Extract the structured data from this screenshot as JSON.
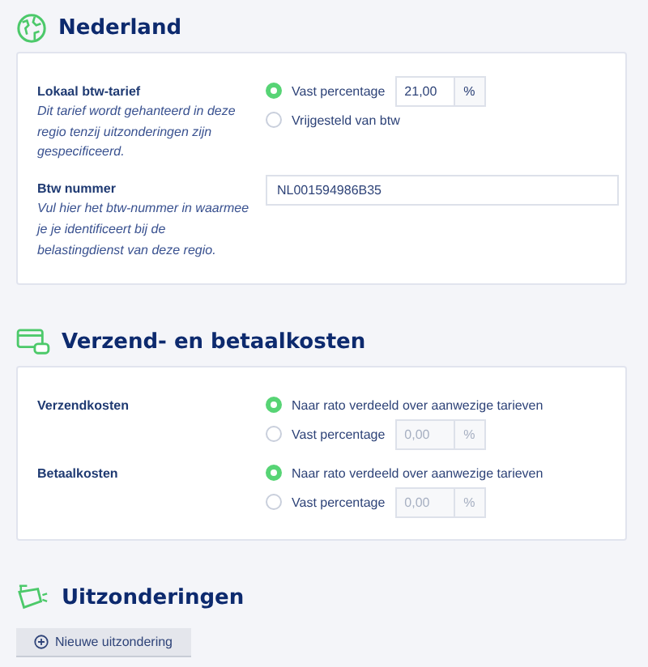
{
  "sections": [
    {
      "title": "Nederland",
      "rows": [
        {
          "label": "Lokaal btw-tarief",
          "description": "Dit tarief wordt gehanteerd in deze regio tenzij uitzonderingen zijn gespecificeerd.",
          "kind": "radio",
          "options": [
            {
              "label": "Vast percentage",
              "selected": true,
              "value": "21,00",
              "unit": "%"
            },
            {
              "label": "Vrijgesteld van btw",
              "selected": false
            }
          ]
        },
        {
          "label": "Btw nummer",
          "description": "Vul hier het btw-nummer in waarmee je je identificeert bij de belastingdienst van deze regio.",
          "kind": "text",
          "value": "NL001594986B35"
        }
      ]
    },
    {
      "title": "Verzend- en betaalkosten",
      "rows": [
        {
          "label": "Verzendkosten",
          "kind": "radio",
          "options": [
            {
              "label": "Naar rato verdeeld over aanwezige tarieven",
              "selected": true
            },
            {
              "label": "Vast percentage",
              "selected": false,
              "value": "0,00",
              "unit": "%"
            }
          ]
        },
        {
          "label": "Betaalkosten",
          "kind": "radio",
          "options": [
            {
              "label": "Naar rato verdeeld over aanwezige tarieven",
              "selected": true
            },
            {
              "label": "Vast percentage",
              "selected": false,
              "value": "0,00",
              "unit": "%"
            }
          ]
        }
      ]
    },
    {
      "title": "Uitzonderingen",
      "button": "Nieuwe uitzondering"
    }
  ]
}
